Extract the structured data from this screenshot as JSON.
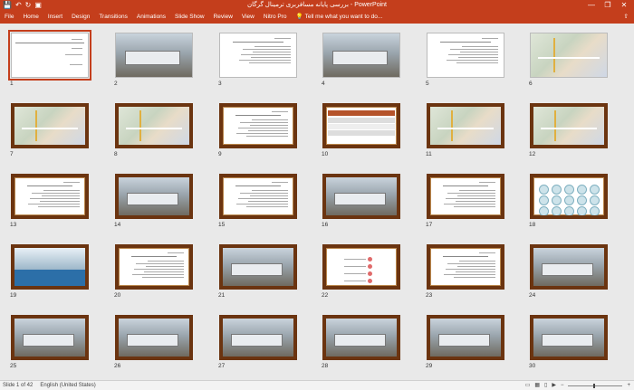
{
  "window": {
    "title": "بررسی پایانه مسافربری ترمینال گرگان  -  PowerPoint",
    "controls": [
      "—",
      "❐",
      "✕"
    ]
  },
  "quick_access": [
    "💾",
    "↶",
    "↻",
    "▣"
  ],
  "ribbon": {
    "tabs": [
      "File",
      "Home",
      "Insert",
      "Design",
      "Transitions",
      "Animations",
      "Slide Show",
      "Review",
      "View",
      "Nitro Pro"
    ],
    "tell_me": "Tell me what you want to do..."
  },
  "slides": [
    {
      "n": "1",
      "kind": "title"
    },
    {
      "n": "2",
      "kind": "photo"
    },
    {
      "n": "3",
      "kind": "text"
    },
    {
      "n": "4",
      "kind": "photo"
    },
    {
      "n": "5",
      "kind": "text"
    },
    {
      "n": "6",
      "kind": "map"
    },
    {
      "n": "7",
      "kind": "map"
    },
    {
      "n": "8",
      "kind": "map"
    },
    {
      "n": "9",
      "kind": "text"
    },
    {
      "n": "10",
      "kind": "table"
    },
    {
      "n": "11",
      "kind": "map"
    },
    {
      "n": "12",
      "kind": "map"
    },
    {
      "n": "13",
      "kind": "text"
    },
    {
      "n": "14",
      "kind": "photo"
    },
    {
      "n": "15",
      "kind": "text"
    },
    {
      "n": "16",
      "kind": "photo"
    },
    {
      "n": "17",
      "kind": "text"
    },
    {
      "n": "18",
      "kind": "diagram"
    },
    {
      "n": "19",
      "kind": "banner"
    },
    {
      "n": "20",
      "kind": "text"
    },
    {
      "n": "21",
      "kind": "photo"
    },
    {
      "n": "22",
      "kind": "list"
    },
    {
      "n": "23",
      "kind": "text"
    },
    {
      "n": "24",
      "kind": "photo"
    },
    {
      "n": "25",
      "kind": "photo"
    },
    {
      "n": "26",
      "kind": "photo"
    },
    {
      "n": "27",
      "kind": "photo"
    },
    {
      "n": "28",
      "kind": "photo"
    },
    {
      "n": "29",
      "kind": "photo"
    },
    {
      "n": "30",
      "kind": "photo"
    }
  ],
  "status": {
    "slide_info": "Slide 1 of 42",
    "language": "English (United States)"
  }
}
